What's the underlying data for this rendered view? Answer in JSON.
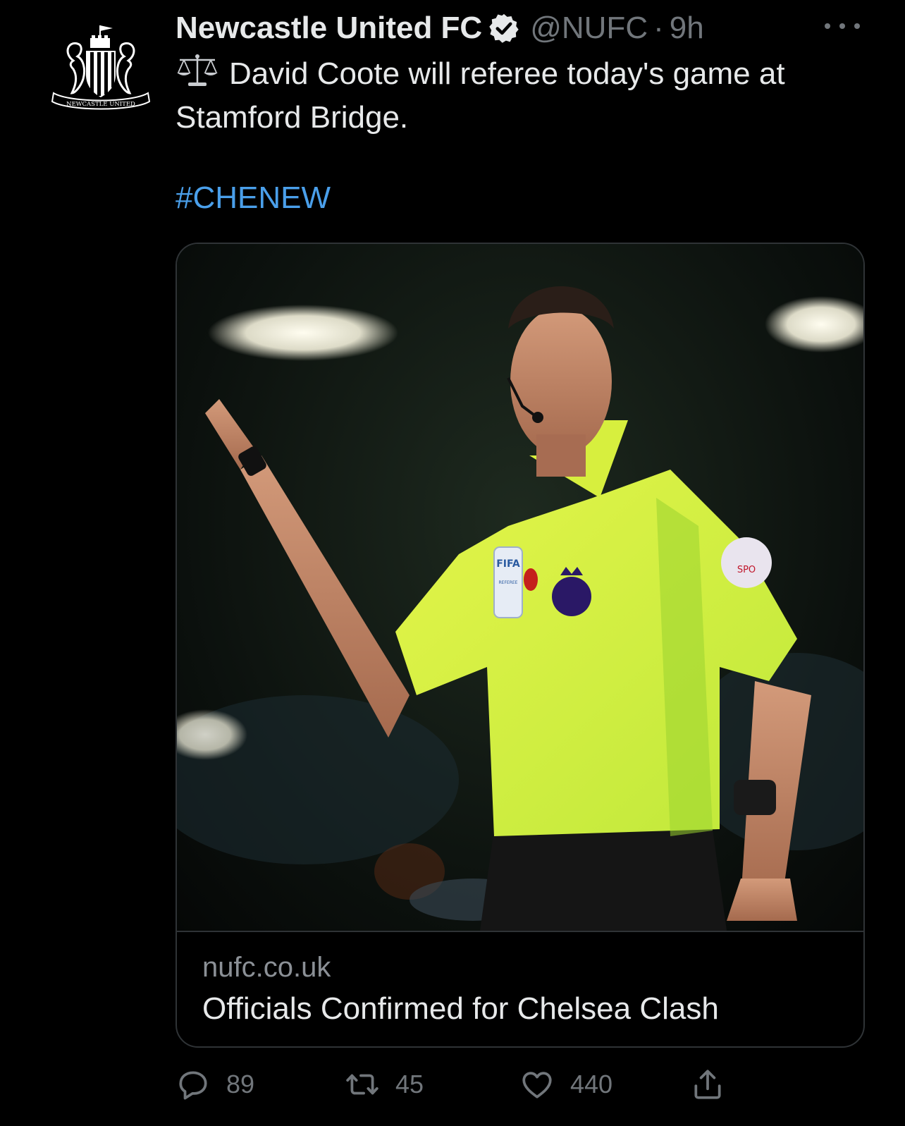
{
  "tweet": {
    "author": {
      "display_name": "Newcastle United FC",
      "handle": "@NUFC",
      "verified": true,
      "avatar_icon": "club-crest-icon",
      "avatar_text": "NEWCASTLE UNITED"
    },
    "separator": "·",
    "time": "9h",
    "more_icon": "ellipsis-icon",
    "text": {
      "emoji_icon": "balance-scale-icon",
      "line1": "David Coote will referee today's game at",
      "line2": "Stamford Bridge."
    },
    "hashtag": "#CHENEW",
    "card": {
      "image_alt": "Referee in a yellow shirt pointing",
      "badge_fifa": "FIFA",
      "badge_referee": "REFEREE",
      "sleeve_text": "SPO",
      "domain": "nufc.co.uk",
      "title": "Officials Confirmed for Chelsea Clash"
    },
    "actions": {
      "reply": {
        "icon": "reply-icon",
        "count": "89"
      },
      "retweet": {
        "icon": "retweet-icon",
        "count": "45"
      },
      "like": {
        "icon": "heart-icon",
        "count": "440"
      },
      "share": {
        "icon": "share-icon"
      }
    },
    "colors": {
      "background": "#000000",
      "text": "#e7e9ea",
      "muted": "#71767b",
      "link": "#4a9fea",
      "border": "#2f3336"
    }
  }
}
